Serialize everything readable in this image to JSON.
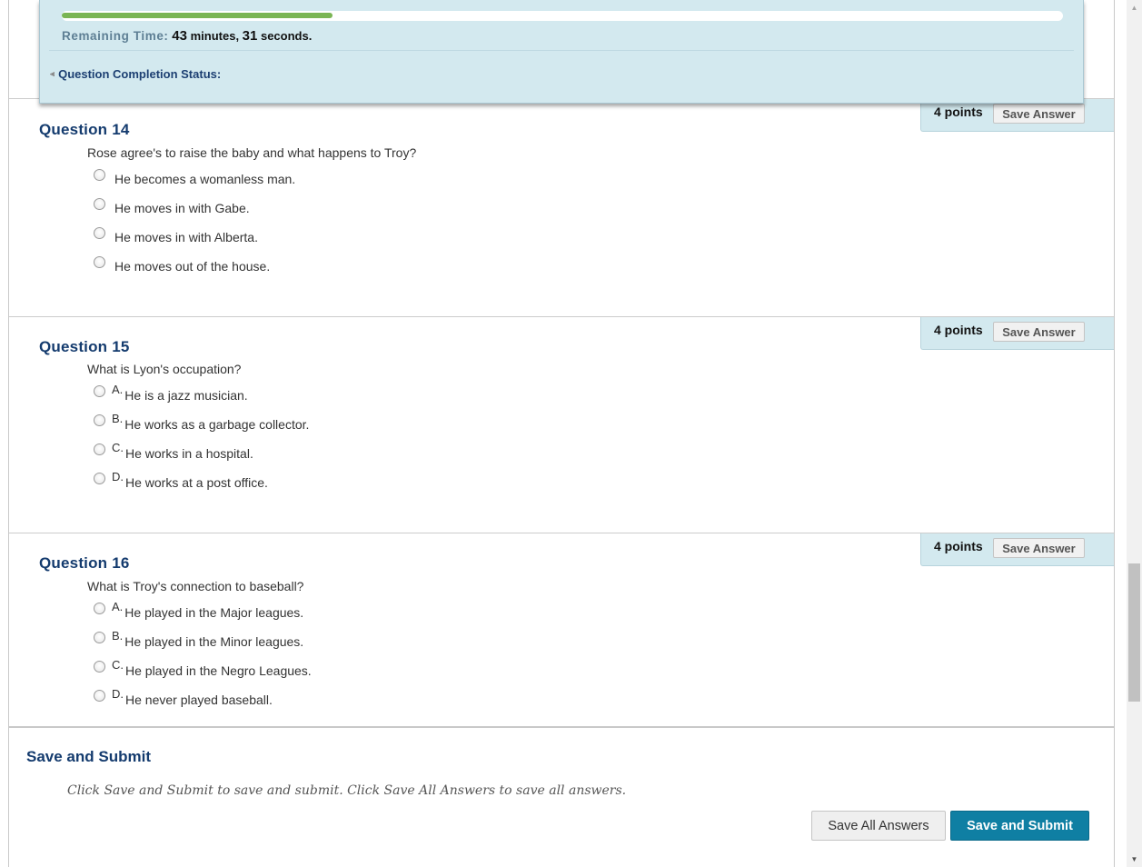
{
  "timer": {
    "progress_fraction": 0.27,
    "remaining_label": "Remaining Time:",
    "minutes_value": "43",
    "minutes_unit": " minutes, ",
    "seconds_value": "31",
    "seconds_unit": " seconds.",
    "completion_label": "Question Completion Status:"
  },
  "questions": [
    {
      "title": "Question 14",
      "text": "Rose agree's to raise the baby and what happens to Troy?",
      "points": "4 points",
      "save_label": "Save Answer",
      "options": [
        {
          "letter": "",
          "text": "He becomes a womanless man."
        },
        {
          "letter": "",
          "text": "He moves in with Gabe."
        },
        {
          "letter": "",
          "text": "He moves in with Alberta."
        },
        {
          "letter": "",
          "text": "He moves out of the house."
        }
      ]
    },
    {
      "title": "Question 15",
      "text": "What is Lyon's occupation?",
      "points": "4 points",
      "save_label": "Save Answer",
      "options": [
        {
          "letter": "A.",
          "text": "He is a jazz musician."
        },
        {
          "letter": "B.",
          "text": "He works as a garbage collector."
        },
        {
          "letter": "C.",
          "text": "He works in a hospital."
        },
        {
          "letter": "D.",
          "text": "He works at a post office."
        }
      ]
    },
    {
      "title": "Question 16",
      "text": "What is Troy's connection to baseball?",
      "points": "4 points",
      "save_label": "Save Answer",
      "options": [
        {
          "letter": "A.",
          "text": "He played in the Major leagues."
        },
        {
          "letter": "B.",
          "text": "He played in the Minor leagues."
        },
        {
          "letter": "C.",
          "text": "He played in the Negro Leagues."
        },
        {
          "letter": "D.",
          "text": "He never played baseball."
        }
      ]
    }
  ],
  "submit": {
    "title": "Save and Submit",
    "instructions": "Click Save and Submit to save and submit. Click Save All Answers to save all answers.",
    "save_all_label": "Save All Answers",
    "submit_label": "Save and Submit"
  },
  "icons": {
    "completion_toggle": "double-chevron-down-icon",
    "scroll_up": "triangle-up-icon",
    "scroll_down": "triangle-down-icon"
  },
  "colors": {
    "panel_bg": "#d3e9ef",
    "title_blue": "#143b6e",
    "progress_green": "#7ab554",
    "submit_button": "#0f7fa3"
  }
}
